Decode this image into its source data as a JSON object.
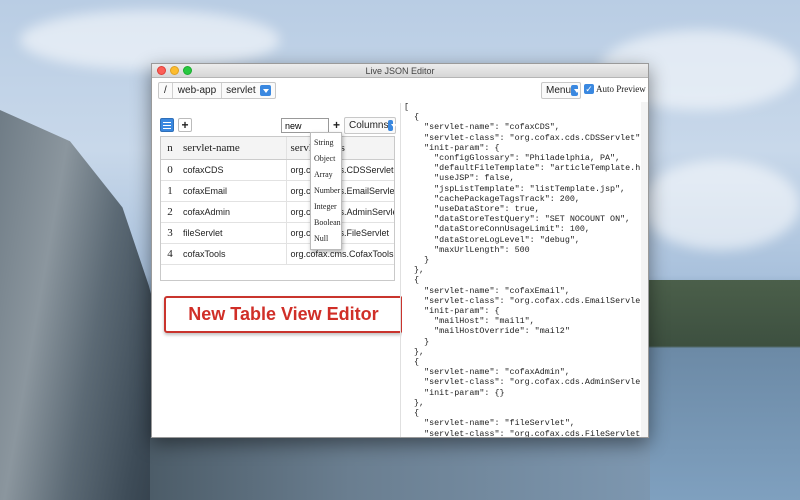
{
  "window": {
    "title": "Live JSON Editor"
  },
  "pathbar": {
    "root": "/",
    "segment": "web-app",
    "selected": "servlet"
  },
  "topbar": {
    "menu_label": "Menu",
    "auto_preview_label": "Auto Preview",
    "auto_preview_checked": true
  },
  "toolbar": {
    "new_value": "new",
    "plus_label": "+",
    "columns_label": "Columns"
  },
  "table": {
    "headers": [
      "n",
      "servlet-name",
      "servlet-class"
    ],
    "rows": [
      {
        "n": "0",
        "name": "cofaxCDS",
        "cls": "org.cofax.cds.CDSServlet"
      },
      {
        "n": "1",
        "name": "cofaxEmail",
        "cls": "org.cofax.cds.EmailServlet"
      },
      {
        "n": "2",
        "name": "cofaxAdmin",
        "cls": "org.cofax.cds.AdminServlet"
      },
      {
        "n": "3",
        "name": "fileServlet",
        "cls": "org.cofax.cds.FileServlet"
      },
      {
        "n": "4",
        "name": "cofaxTools",
        "cls": "org.cofax.cms.CofaxToolsServlet"
      }
    ]
  },
  "type_menu": {
    "items": [
      "String",
      "Object",
      "Array",
      "Number",
      "Integer",
      "Boolean",
      "Null"
    ]
  },
  "callout": {
    "text": "New Table View Editor"
  },
  "json_preview": {
    "text": "[\n  {\n    \"servlet-name\": \"cofaxCDS\",\n    \"servlet-class\": \"org.cofax.cds.CDSServlet\",\n    \"init-param\": {\n      \"configGlossary\": \"Philadelphia, PA\",\n      \"defaultFileTemplate\": \"articleTemplate.htm\",\n      \"useJSP\": false,\n      \"jspListTemplate\": \"listTemplate.jsp\",\n      \"cachePackageTagsTrack\": 200,\n      \"useDataStore\": true,\n      \"dataStoreTestQuery\": \"SET NOCOUNT ON\",\n      \"dataStoreConnUsageLimit\": 100,\n      \"dataStoreLogLevel\": \"debug\",\n      \"maxUrlLength\": 500\n    }\n  },\n  {\n    \"servlet-name\": \"cofaxEmail\",\n    \"servlet-class\": \"org.cofax.cds.EmailServlet\",\n    \"init-param\": {\n      \"mailHost\": \"mail1\",\n      \"mailHostOverride\": \"mail2\"\n    }\n  },\n  {\n    \"servlet-name\": \"cofaxAdmin\",\n    \"servlet-class\": \"org.cofax.cds.AdminServlet\",\n    \"init-param\": {}\n  },\n  {\n    \"servlet-name\": \"fileServlet\",\n    \"servlet-class\": \"org.cofax.cds.FileServlet\",\n    \"init-param\": {}\n  },\n  {"
  }
}
